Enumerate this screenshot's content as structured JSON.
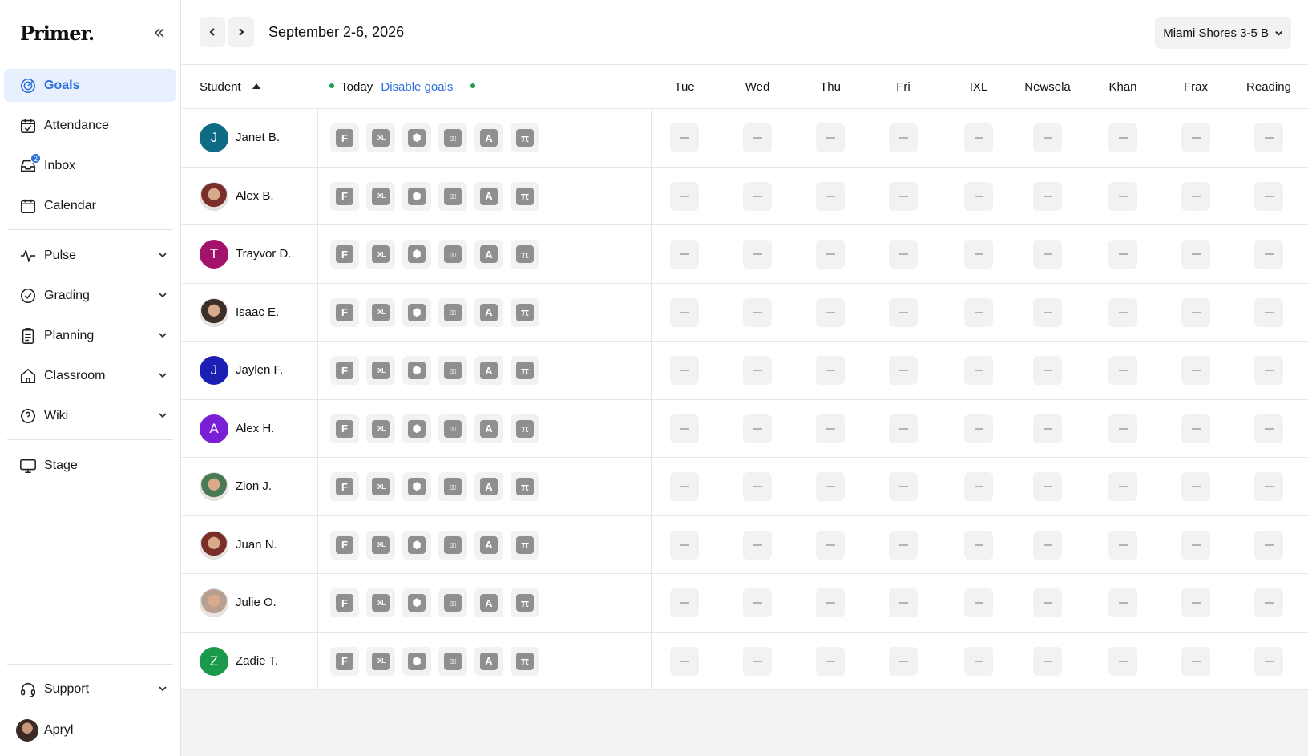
{
  "app": {
    "logo": "Primer."
  },
  "sidebar": {
    "items": [
      {
        "id": "goals",
        "label": "Goals",
        "icon": "goals-icon",
        "active": true
      },
      {
        "id": "attendance",
        "label": "Attendance",
        "icon": "calendar-check-icon"
      },
      {
        "id": "inbox",
        "label": "Inbox",
        "icon": "inbox-icon",
        "badge": "2"
      },
      {
        "id": "calendar",
        "label": "Calendar",
        "icon": "calendar-icon"
      },
      {
        "id": "pulse",
        "label": "Pulse",
        "icon": "pulse-icon",
        "expandable": true
      },
      {
        "id": "grading",
        "label": "Grading",
        "icon": "check-circle-icon",
        "expandable": true
      },
      {
        "id": "planning",
        "label": "Planning",
        "icon": "clipboard-icon",
        "expandable": true
      },
      {
        "id": "classroom",
        "label": "Classroom",
        "icon": "home-icon",
        "expandable": true
      },
      {
        "id": "wiki",
        "label": "Wiki",
        "icon": "help-circle-icon",
        "expandable": true
      },
      {
        "id": "stage",
        "label": "Stage",
        "icon": "monitor-icon"
      }
    ],
    "support_label": "Support",
    "user_name": "Apryl"
  },
  "header": {
    "date_range": "September 2-6, 2026",
    "class_select": "Miami Shores 3-5 B"
  },
  "table": {
    "columns": {
      "student": "Student",
      "today": "Today",
      "disable_goals": "Disable goals",
      "days": [
        "Tue",
        "Wed",
        "Thu",
        "Fri"
      ],
      "apps": [
        "IXL",
        "Newsela",
        "Khan",
        "Frax",
        "Reading"
      ]
    },
    "app_icons": [
      {
        "name": "frax-app-icon",
        "glyph": "F"
      },
      {
        "name": "ixl-app-icon",
        "glyph": "IXL"
      },
      {
        "name": "khan-app-icon",
        "glyph": "⬢"
      },
      {
        "name": "reading-app-icon",
        "glyph": "▯▯"
      },
      {
        "name": "alpha-read-app-icon",
        "glyph": "A"
      },
      {
        "name": "math-app-icon",
        "glyph": "π"
      }
    ],
    "students": [
      {
        "name": "Janet B.",
        "initial": "J",
        "color": "#0e6b84"
      },
      {
        "name": "Alex B.",
        "photo": true,
        "tone": "#7a2e2a"
      },
      {
        "name": "Trayvor D.",
        "initial": "T",
        "color": "#a3136b"
      },
      {
        "name": "Isaac E.",
        "photo": true,
        "tone": "#3d2e2a"
      },
      {
        "name": "Jaylen F.",
        "initial": "J",
        "color": "#1b1fb3"
      },
      {
        "name": "Alex H.",
        "initial": "A",
        "color": "#7b1fd6"
      },
      {
        "name": "Zion J.",
        "photo": true,
        "tone": "#4a7a55"
      },
      {
        "name": "Juan N.",
        "photo": true,
        "tone": "#7a2e2a"
      },
      {
        "name": "Julie O.",
        "photo": true,
        "tone": "#b8a090"
      },
      {
        "name": "Zadie T.",
        "initial": "Z",
        "color": "#1a9a4a"
      }
    ]
  }
}
